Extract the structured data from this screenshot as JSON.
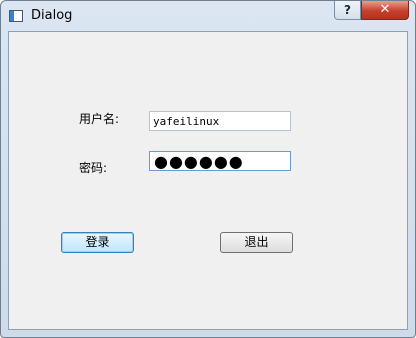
{
  "window": {
    "title": "Dialog",
    "help_glyph": "?",
    "close_glyph": "✕",
    "icon": "app-window-icon"
  },
  "form": {
    "username_label": "用户名:",
    "username_value": "yafeilinux",
    "password_label": "密码:",
    "password_masked": "●●●●●●"
  },
  "buttons": {
    "login_label": "登录",
    "exit_label": "退出"
  },
  "colors": {
    "title_bar": "#cfdbe9",
    "client_background": "#f0f0f0",
    "close_button": "#c5402b",
    "focus_border": "#6a9bd1"
  }
}
